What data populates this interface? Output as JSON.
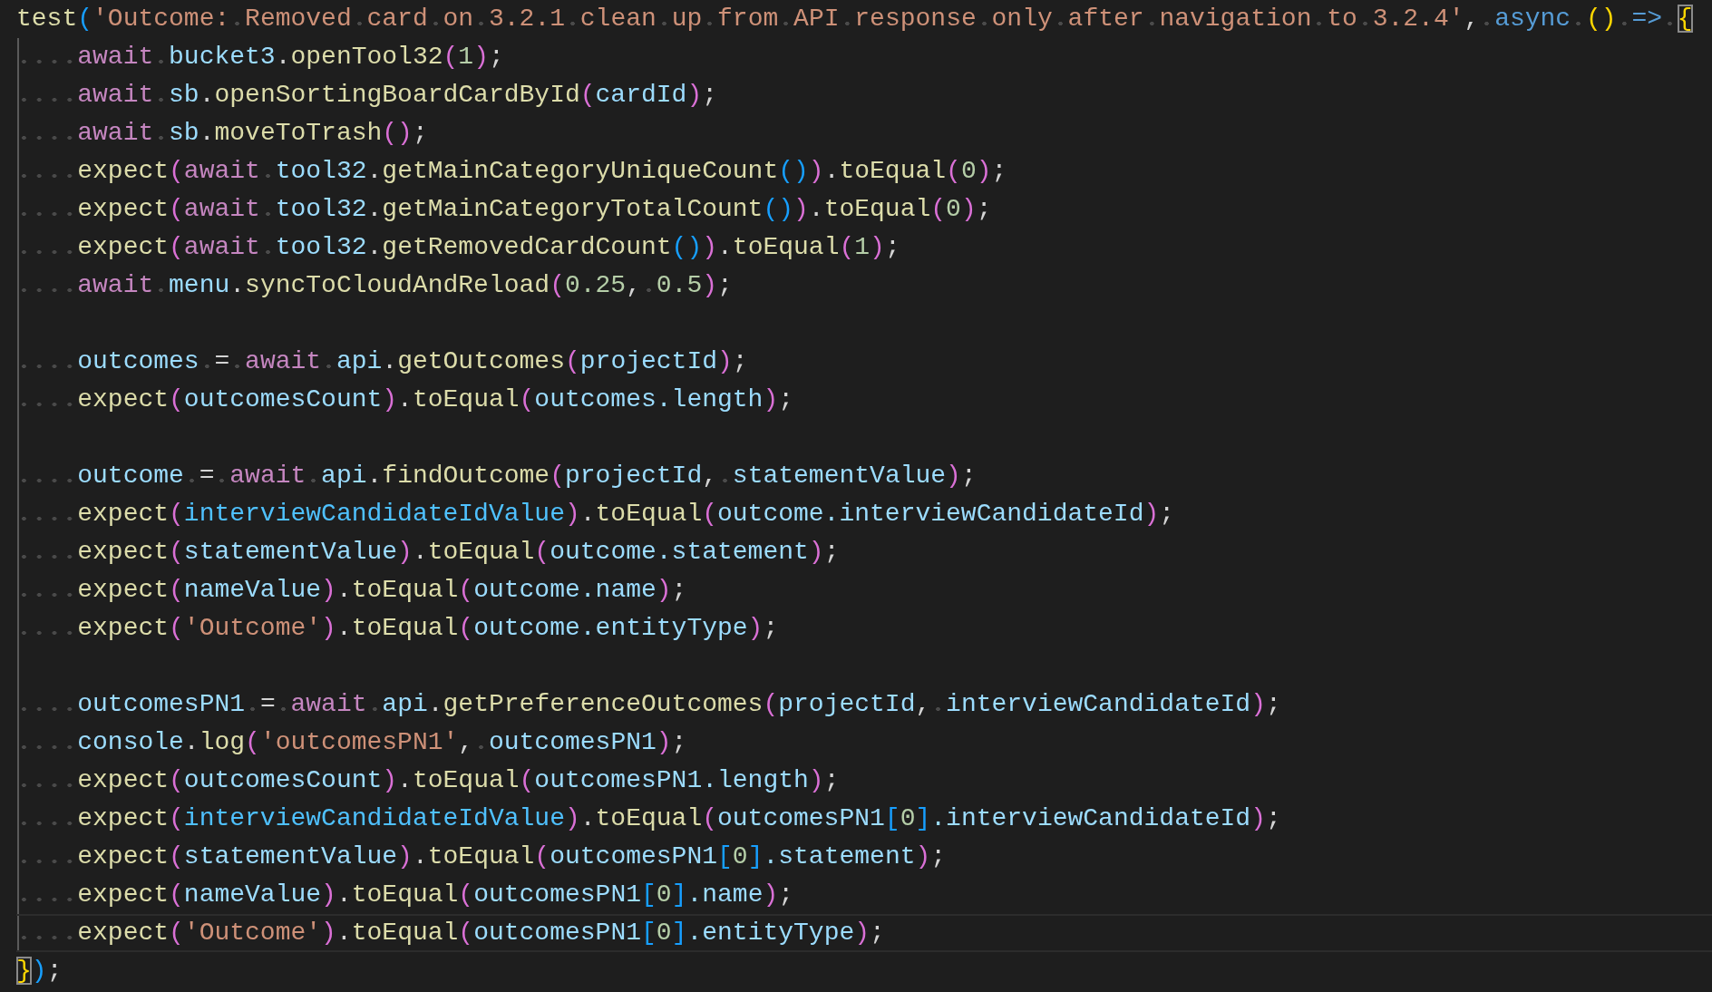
{
  "editor": {
    "lines": [
      {
        "kind": "code",
        "tokens": [
          {
            "kind": "fn",
            "text": "test"
          },
          {
            "kind": "b3",
            "text": "("
          },
          {
            "kind": "str",
            "text": "'Outcome: Removed card on 3.2.1 clean up from API response only after navigation to 3.2.4'"
          },
          {
            "kind": "punc",
            "text": ", "
          },
          {
            "kind": "storage",
            "text": "async "
          },
          {
            "kind": "b1",
            "text": "() "
          },
          {
            "kind": "storage",
            "text": "=> "
          },
          {
            "kind": "b1",
            "text": "{",
            "boxed": true
          }
        ]
      },
      {
        "kind": "code",
        "tokens": [
          {
            "kind": "kw",
            "text": "    await "
          },
          {
            "kind": "var",
            "text": "bucket3"
          },
          {
            "kind": "punc",
            "text": "."
          },
          {
            "kind": "fn",
            "text": "openTool32"
          },
          {
            "kind": "b2",
            "text": "("
          },
          {
            "kind": "num",
            "text": "1"
          },
          {
            "kind": "b2",
            "text": ")"
          },
          {
            "kind": "punc",
            "text": ";"
          }
        ]
      },
      {
        "kind": "code",
        "tokens": [
          {
            "kind": "kw",
            "text": "    await "
          },
          {
            "kind": "var",
            "text": "sb"
          },
          {
            "kind": "punc",
            "text": "."
          },
          {
            "kind": "fn",
            "text": "openSortingBoardCardById"
          },
          {
            "kind": "b2",
            "text": "("
          },
          {
            "kind": "var",
            "text": "cardId"
          },
          {
            "kind": "b2",
            "text": ")"
          },
          {
            "kind": "punc",
            "text": ";"
          }
        ]
      },
      {
        "kind": "code",
        "tokens": [
          {
            "kind": "kw",
            "text": "    await "
          },
          {
            "kind": "var",
            "text": "sb"
          },
          {
            "kind": "punc",
            "text": "."
          },
          {
            "kind": "fn",
            "text": "moveToTrash"
          },
          {
            "kind": "b2",
            "text": "()"
          },
          {
            "kind": "punc",
            "text": ";"
          }
        ]
      },
      {
        "kind": "code",
        "tokens": [
          {
            "kind": "fn",
            "text": "    expect"
          },
          {
            "kind": "b2",
            "text": "("
          },
          {
            "kind": "kw",
            "text": "await "
          },
          {
            "kind": "var",
            "text": "tool32"
          },
          {
            "kind": "punc",
            "text": "."
          },
          {
            "kind": "fn",
            "text": "getMainCategoryUniqueCount"
          },
          {
            "kind": "b3",
            "text": "()"
          },
          {
            "kind": "b2",
            "text": ")"
          },
          {
            "kind": "punc",
            "text": "."
          },
          {
            "kind": "fn",
            "text": "toEqual"
          },
          {
            "kind": "b2",
            "text": "("
          },
          {
            "kind": "num",
            "text": "0"
          },
          {
            "kind": "b2",
            "text": ")"
          },
          {
            "kind": "punc",
            "text": ";"
          }
        ]
      },
      {
        "kind": "code",
        "tokens": [
          {
            "kind": "fn",
            "text": "    expect"
          },
          {
            "kind": "b2",
            "text": "("
          },
          {
            "kind": "kw",
            "text": "await "
          },
          {
            "kind": "var",
            "text": "tool32"
          },
          {
            "kind": "punc",
            "text": "."
          },
          {
            "kind": "fn",
            "text": "getMainCategoryTotalCount"
          },
          {
            "kind": "b3",
            "text": "()"
          },
          {
            "kind": "b2",
            "text": ")"
          },
          {
            "kind": "punc",
            "text": "."
          },
          {
            "kind": "fn",
            "text": "toEqual"
          },
          {
            "kind": "b2",
            "text": "("
          },
          {
            "kind": "num",
            "text": "0"
          },
          {
            "kind": "b2",
            "text": ")"
          },
          {
            "kind": "punc",
            "text": ";"
          }
        ]
      },
      {
        "kind": "code",
        "tokens": [
          {
            "kind": "fn",
            "text": "    expect"
          },
          {
            "kind": "b2",
            "text": "("
          },
          {
            "kind": "kw",
            "text": "await "
          },
          {
            "kind": "var",
            "text": "tool32"
          },
          {
            "kind": "punc",
            "text": "."
          },
          {
            "kind": "fn",
            "text": "getRemovedCardCount"
          },
          {
            "kind": "b3",
            "text": "()"
          },
          {
            "kind": "b2",
            "text": ")"
          },
          {
            "kind": "punc",
            "text": "."
          },
          {
            "kind": "fn",
            "text": "toEqual"
          },
          {
            "kind": "b2",
            "text": "("
          },
          {
            "kind": "num",
            "text": "1"
          },
          {
            "kind": "b2",
            "text": ")"
          },
          {
            "kind": "punc",
            "text": ";"
          }
        ]
      },
      {
        "kind": "code",
        "tokens": [
          {
            "kind": "kw",
            "text": "    await "
          },
          {
            "kind": "var",
            "text": "menu"
          },
          {
            "kind": "punc",
            "text": "."
          },
          {
            "kind": "fn",
            "text": "syncToCloudAndReload"
          },
          {
            "kind": "b2",
            "text": "("
          },
          {
            "kind": "num",
            "text": "0.25"
          },
          {
            "kind": "punc",
            "text": ", "
          },
          {
            "kind": "num",
            "text": "0.5"
          },
          {
            "kind": "b2",
            "text": ")"
          },
          {
            "kind": "punc",
            "text": ";"
          }
        ]
      },
      {
        "kind": "blank"
      },
      {
        "kind": "code",
        "tokens": [
          {
            "kind": "var",
            "text": "    outcomes"
          },
          {
            "kind": "punc",
            "text": " = "
          },
          {
            "kind": "kw",
            "text": "await "
          },
          {
            "kind": "var",
            "text": "api"
          },
          {
            "kind": "punc",
            "text": "."
          },
          {
            "kind": "fn",
            "text": "getOutcomes"
          },
          {
            "kind": "b2",
            "text": "("
          },
          {
            "kind": "var",
            "text": "projectId"
          },
          {
            "kind": "b2",
            "text": ")"
          },
          {
            "kind": "punc",
            "text": ";"
          }
        ]
      },
      {
        "kind": "code",
        "tokens": [
          {
            "kind": "fn",
            "text": "    expect"
          },
          {
            "kind": "b2",
            "text": "("
          },
          {
            "kind": "var",
            "text": "outcomesCount"
          },
          {
            "kind": "b2",
            "text": ")"
          },
          {
            "kind": "punc",
            "text": "."
          },
          {
            "kind": "fn",
            "text": "toEqual"
          },
          {
            "kind": "b2",
            "text": "("
          },
          {
            "kind": "var",
            "text": "outcomes.length"
          },
          {
            "kind": "b2",
            "text": ")"
          },
          {
            "kind": "punc",
            "text": ";"
          }
        ]
      },
      {
        "kind": "blank"
      },
      {
        "kind": "code",
        "tokens": [
          {
            "kind": "var",
            "text": "    outcome"
          },
          {
            "kind": "punc",
            "text": " = "
          },
          {
            "kind": "kw",
            "text": "await "
          },
          {
            "kind": "var",
            "text": "api"
          },
          {
            "kind": "punc",
            "text": "."
          },
          {
            "kind": "fn",
            "text": "findOutcome"
          },
          {
            "kind": "b2",
            "text": "("
          },
          {
            "kind": "var",
            "text": "projectId"
          },
          {
            "kind": "punc",
            "text": ", "
          },
          {
            "kind": "var",
            "text": "statementValue"
          },
          {
            "kind": "b2",
            "text": ")"
          },
          {
            "kind": "punc",
            "text": ";"
          }
        ]
      },
      {
        "kind": "code",
        "tokens": [
          {
            "kind": "fn",
            "text": "    expect"
          },
          {
            "kind": "b2",
            "text": "("
          },
          {
            "kind": "const",
            "text": "interviewCandidateIdValue"
          },
          {
            "kind": "b2",
            "text": ")"
          },
          {
            "kind": "punc",
            "text": "."
          },
          {
            "kind": "fn",
            "text": "toEqual"
          },
          {
            "kind": "b2",
            "text": "("
          },
          {
            "kind": "var",
            "text": "outcome.interviewCandidateId"
          },
          {
            "kind": "b2",
            "text": ")"
          },
          {
            "kind": "punc",
            "text": ";"
          }
        ]
      },
      {
        "kind": "code",
        "tokens": [
          {
            "kind": "fn",
            "text": "    expect"
          },
          {
            "kind": "b2",
            "text": "("
          },
          {
            "kind": "var",
            "text": "statementValue"
          },
          {
            "kind": "b2",
            "text": ")"
          },
          {
            "kind": "punc",
            "text": "."
          },
          {
            "kind": "fn",
            "text": "toEqual"
          },
          {
            "kind": "b2",
            "text": "("
          },
          {
            "kind": "var",
            "text": "outcome.statement"
          },
          {
            "kind": "b2",
            "text": ")"
          },
          {
            "kind": "punc",
            "text": ";"
          }
        ]
      },
      {
        "kind": "code",
        "tokens": [
          {
            "kind": "fn",
            "text": "    expect"
          },
          {
            "kind": "b2",
            "text": "("
          },
          {
            "kind": "var",
            "text": "nameValue"
          },
          {
            "kind": "b2",
            "text": ")"
          },
          {
            "kind": "punc",
            "text": "."
          },
          {
            "kind": "fn",
            "text": "toEqual"
          },
          {
            "kind": "b2",
            "text": "("
          },
          {
            "kind": "var",
            "text": "outcome.name"
          },
          {
            "kind": "b2",
            "text": ")"
          },
          {
            "kind": "punc",
            "text": ";"
          }
        ]
      },
      {
        "kind": "code",
        "tokens": [
          {
            "kind": "fn",
            "text": "    expect"
          },
          {
            "kind": "b2",
            "text": "("
          },
          {
            "kind": "str",
            "text": "'Outcome'"
          },
          {
            "kind": "b2",
            "text": ")"
          },
          {
            "kind": "punc",
            "text": "."
          },
          {
            "kind": "fn",
            "text": "toEqual"
          },
          {
            "kind": "b2",
            "text": "("
          },
          {
            "kind": "var",
            "text": "outcome.entityType"
          },
          {
            "kind": "b2",
            "text": ")"
          },
          {
            "kind": "punc",
            "text": ";"
          }
        ]
      },
      {
        "kind": "blank"
      },
      {
        "kind": "code",
        "tokens": [
          {
            "kind": "var",
            "text": "    outcomesPN1"
          },
          {
            "kind": "punc",
            "text": " = "
          },
          {
            "kind": "kw",
            "text": "await "
          },
          {
            "kind": "var",
            "text": "api"
          },
          {
            "kind": "punc",
            "text": "."
          },
          {
            "kind": "fn",
            "text": "getPreferenceOutcomes"
          },
          {
            "kind": "b2",
            "text": "("
          },
          {
            "kind": "var",
            "text": "projectId"
          },
          {
            "kind": "punc",
            "text": ", "
          },
          {
            "kind": "var",
            "text": "interviewCandidateId"
          },
          {
            "kind": "b2",
            "text": ")"
          },
          {
            "kind": "punc",
            "text": ";"
          }
        ]
      },
      {
        "kind": "code",
        "tokens": [
          {
            "kind": "var",
            "text": "    console"
          },
          {
            "kind": "punc",
            "text": "."
          },
          {
            "kind": "fn",
            "text": "log"
          },
          {
            "kind": "b2",
            "text": "("
          },
          {
            "kind": "str",
            "text": "'outcomesPN1'"
          },
          {
            "kind": "punc",
            "text": ", "
          },
          {
            "kind": "var",
            "text": "outcomesPN1"
          },
          {
            "kind": "b2",
            "text": ")"
          },
          {
            "kind": "punc",
            "text": ";"
          }
        ]
      },
      {
        "kind": "code",
        "tokens": [
          {
            "kind": "fn",
            "text": "    expect"
          },
          {
            "kind": "b2",
            "text": "("
          },
          {
            "kind": "var",
            "text": "outcomesCount"
          },
          {
            "kind": "b2",
            "text": ")"
          },
          {
            "kind": "punc",
            "text": "."
          },
          {
            "kind": "fn",
            "text": "toEqual"
          },
          {
            "kind": "b2",
            "text": "("
          },
          {
            "kind": "var",
            "text": "outcomesPN1.length"
          },
          {
            "kind": "b2",
            "text": ")"
          },
          {
            "kind": "punc",
            "text": ";"
          }
        ]
      },
      {
        "kind": "code",
        "tokens": [
          {
            "kind": "fn",
            "text": "    expect"
          },
          {
            "kind": "b2",
            "text": "("
          },
          {
            "kind": "const",
            "text": "interviewCandidateIdValue"
          },
          {
            "kind": "b2",
            "text": ")"
          },
          {
            "kind": "punc",
            "text": "."
          },
          {
            "kind": "fn",
            "text": "toEqual"
          },
          {
            "kind": "b2",
            "text": "("
          },
          {
            "kind": "var",
            "text": "outcomesPN1"
          },
          {
            "kind": "b3",
            "text": "["
          },
          {
            "kind": "num",
            "text": "0"
          },
          {
            "kind": "b3",
            "text": "]"
          },
          {
            "kind": "var",
            "text": ".interviewCandidateId"
          },
          {
            "kind": "b2",
            "text": ")"
          },
          {
            "kind": "punc",
            "text": ";"
          }
        ]
      },
      {
        "kind": "code",
        "tokens": [
          {
            "kind": "fn",
            "text": "    expect"
          },
          {
            "kind": "b2",
            "text": "("
          },
          {
            "kind": "var",
            "text": "statementValue"
          },
          {
            "kind": "b2",
            "text": ")"
          },
          {
            "kind": "punc",
            "text": "."
          },
          {
            "kind": "fn",
            "text": "toEqual"
          },
          {
            "kind": "b2",
            "text": "("
          },
          {
            "kind": "var",
            "text": "outcomesPN1"
          },
          {
            "kind": "b3",
            "text": "["
          },
          {
            "kind": "num",
            "text": "0"
          },
          {
            "kind": "b3",
            "text": "]"
          },
          {
            "kind": "var",
            "text": ".statement"
          },
          {
            "kind": "b2",
            "text": ")"
          },
          {
            "kind": "punc",
            "text": ";"
          }
        ]
      },
      {
        "kind": "code",
        "tokens": [
          {
            "kind": "fn",
            "text": "    expect"
          },
          {
            "kind": "b2",
            "text": "("
          },
          {
            "kind": "var",
            "text": "nameValue"
          },
          {
            "kind": "b2",
            "text": ")"
          },
          {
            "kind": "punc",
            "text": "."
          },
          {
            "kind": "fn",
            "text": "toEqual"
          },
          {
            "kind": "b2",
            "text": "("
          },
          {
            "kind": "var",
            "text": "outcomesPN1"
          },
          {
            "kind": "b3",
            "text": "["
          },
          {
            "kind": "num",
            "text": "0"
          },
          {
            "kind": "b3",
            "text": "]"
          },
          {
            "kind": "var",
            "text": ".name"
          },
          {
            "kind": "b2",
            "text": ")"
          },
          {
            "kind": "punc",
            "text": ";"
          }
        ]
      },
      {
        "kind": "code",
        "current": true,
        "tokens": [
          {
            "kind": "fn",
            "text": "    expect"
          },
          {
            "kind": "b2",
            "text": "("
          },
          {
            "kind": "str",
            "text": "'Outcome'"
          },
          {
            "kind": "b2",
            "text": ")"
          },
          {
            "kind": "punc",
            "text": "."
          },
          {
            "kind": "fn",
            "text": "toEqual"
          },
          {
            "kind": "b2",
            "text": "("
          },
          {
            "kind": "var",
            "text": "outcomesPN1"
          },
          {
            "kind": "b3",
            "text": "["
          },
          {
            "kind": "num",
            "text": "0"
          },
          {
            "kind": "b3",
            "text": "]"
          },
          {
            "kind": "var",
            "text": ".entityType"
          },
          {
            "kind": "b2",
            "text": ")"
          },
          {
            "kind": "punc",
            "text": ";"
          }
        ]
      },
      {
        "kind": "code",
        "tokens": [
          {
            "kind": "b1",
            "text": "}",
            "boxed": true
          },
          {
            "kind": "b3",
            "text": ")"
          },
          {
            "kind": "punc",
            "text": ";"
          }
        ]
      }
    ]
  }
}
